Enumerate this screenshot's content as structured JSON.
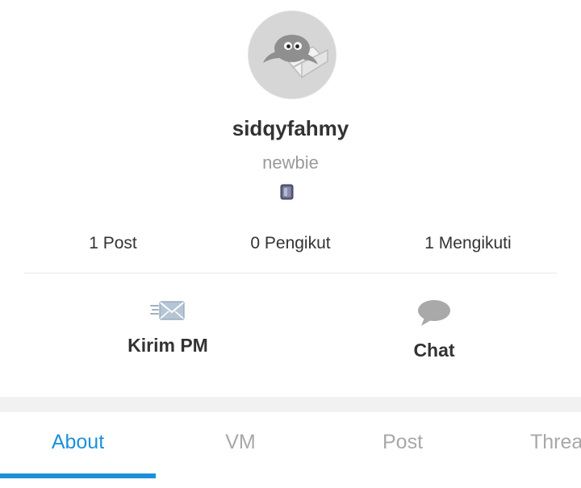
{
  "profile": {
    "username": "sidqyfahmy",
    "rank": "newbie",
    "avatar_icon": "avatar-placeholder-icon",
    "rank_badge_icon": "rank-badge-icon"
  },
  "stats": [
    {
      "label": "1 Post"
    },
    {
      "label": "0 Pengikut"
    },
    {
      "label": "1 Mengikuti"
    }
  ],
  "actions": {
    "pm": {
      "label": "Kirim PM",
      "icon": "send-message-icon"
    },
    "chat": {
      "label": "Chat",
      "icon": "chat-bubble-icon"
    }
  },
  "tabs": [
    {
      "label": "About",
      "active": true
    },
    {
      "label": "VM",
      "active": false
    },
    {
      "label": "Post",
      "active": false
    },
    {
      "label": "Threa",
      "active": false
    }
  ],
  "colors": {
    "accent": "#1e90d8",
    "text": "#333333",
    "muted": "#9a9a9a"
  }
}
